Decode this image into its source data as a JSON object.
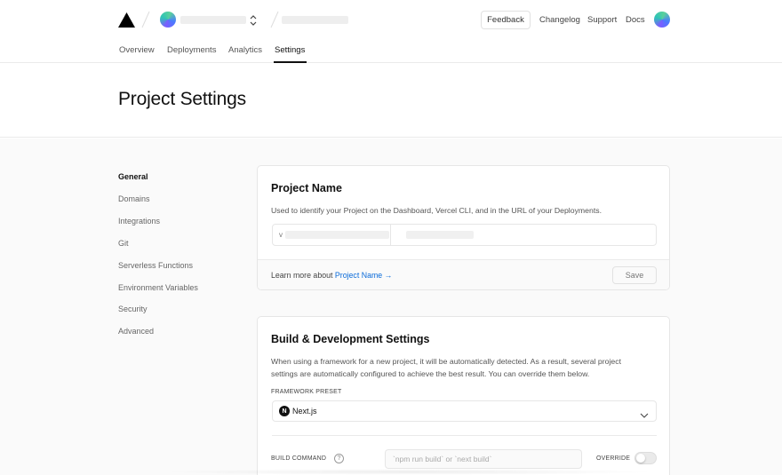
{
  "header": {
    "feedback_label": "Feedback",
    "links": [
      "Changelog",
      "Support",
      "Docs"
    ]
  },
  "tabs": [
    {
      "label": "Overview",
      "active": false
    },
    {
      "label": "Deployments",
      "active": false
    },
    {
      "label": "Analytics",
      "active": false
    },
    {
      "label": "Settings",
      "active": true
    }
  ],
  "page": {
    "title": "Project Settings"
  },
  "sidebar": {
    "items": [
      {
        "label": "General",
        "active": true
      },
      {
        "label": "Domains",
        "active": false
      },
      {
        "label": "Integrations",
        "active": false
      },
      {
        "label": "Git",
        "active": false
      },
      {
        "label": "Serverless Functions",
        "active": false
      },
      {
        "label": "Environment Variables",
        "active": false
      },
      {
        "label": "Security",
        "active": false
      },
      {
        "label": "Advanced",
        "active": false
      }
    ]
  },
  "project_name_card": {
    "title": "Project Name",
    "description": "Used to identify your Project on the Dashboard, Vercel CLI, and in the URL of your Deployments.",
    "input_value_prefix": "v",
    "footer_prefix": "Learn more about ",
    "footer_link": "Project Name →",
    "save_label": "Save"
  },
  "build_card": {
    "title": "Build & Development Settings",
    "description_line1": "When using a framework for a new project, it will be automatically detected. As a result, several project",
    "description_line2": "settings are automatically configured to achieve the best result. You can override them below.",
    "framework_label": "FRAMEWORK PRESET",
    "framework_value": "Next.js",
    "framework_logo": "N",
    "build_command_label": "BUILD COMMAND",
    "build_command_help": "?",
    "build_command_placeholder": "`npm run build` or `next build`",
    "override_label": "OVERRIDE",
    "override_on": false
  },
  "colors": {
    "link": "#0b6bd9",
    "text": "#111111",
    "muted": "#666666",
    "border": "#eaeaea"
  }
}
